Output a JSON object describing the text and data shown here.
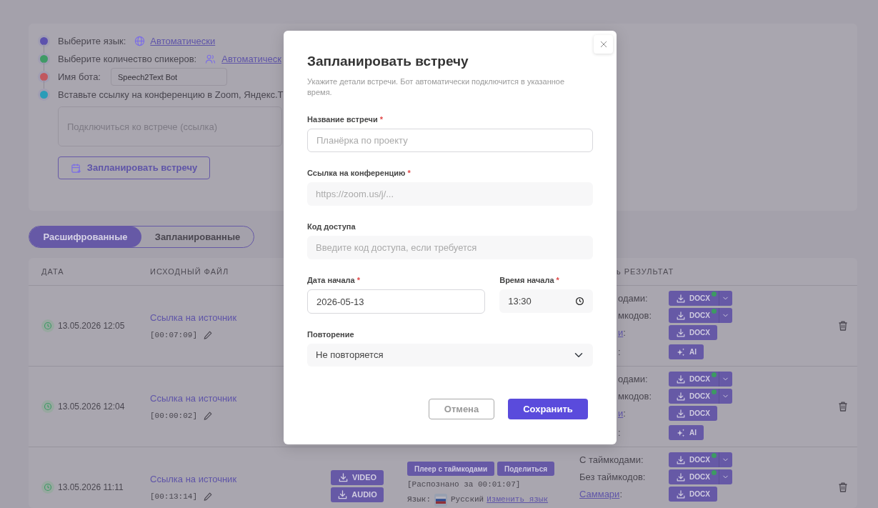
{
  "settings": {
    "items": [
      {
        "kind": "language",
        "color": "#5c52ad",
        "label": "Выберите язык:",
        "value": "Автоматически"
      },
      {
        "kind": "speakers",
        "color": "#3f9a66",
        "label": "Выберите количество спикеров:",
        "value": "Автоматическ"
      },
      {
        "kind": "bot_name",
        "color": "#c0575f",
        "label": "Имя бота:",
        "value": "Speech2Text Bot"
      },
      {
        "kind": "text",
        "color": "#2a9cb8",
        "label": "Вставьте ссылку на конференцию в Zoom, Яндекс.Т"
      }
    ],
    "link_field": {
      "placeholder": "Подключиться ко встрече (ссылка)"
    },
    "schedule_button": "Запланировать встречу"
  },
  "tabs": [
    {
      "label": "Расшифрованные",
      "selected": true
    },
    {
      "label": "Запланированные",
      "selected": false
    }
  ],
  "table": {
    "columns": [
      "ДАТА",
      "ИСХОДНЫЙ ФАЙЛ",
      "ь РЕЗУЛЬТАТ"
    ],
    "rows": [
      {
        "kind": "covered",
        "date": "13.05.2026 12:05",
        "source": "Ссылка на источник",
        "duration": "[00:07:09]",
        "results": [
          {
            "label": "одами:",
            "buttons": [
              {
                "kind": "download",
                "label": "DOCX",
                "split": true,
                "indicator": true
              }
            ]
          },
          {
            "label": "мкодов:",
            "buttons": [
              {
                "kind": "download",
                "label": "DOCX",
                "split": true,
                "indicator": true
              }
            ]
          },
          {
            "link": "и",
            "label": ":",
            "buttons": [
              {
                "kind": "download",
                "label": "DOCX",
                "split": false,
                "indicator": false
              }
            ]
          },
          {
            "kind": "ai",
            "label": ":",
            "buttons": [
              {
                "kind": "ai",
                "label": "AI",
                "split": false,
                "indicator": false
              }
            ]
          }
        ]
      },
      {
        "kind": "covered",
        "date": "13.05.2026 12:04",
        "source": "Ссылка на источник",
        "duration": "[00:00:02]",
        "results": [
          {
            "label": "одами:",
            "buttons": [
              {
                "kind": "download",
                "label": "DOCX",
                "split": true,
                "indicator": true
              }
            ]
          },
          {
            "label": "мкодов:",
            "buttons": [
              {
                "kind": "download",
                "label": "DOCX",
                "split": true,
                "indicator": true
              }
            ]
          },
          {
            "link": "и",
            "label": ":",
            "buttons": [
              {
                "kind": "download",
                "label": "DOCX",
                "split": false,
                "indicator": false
              }
            ]
          },
          {
            "kind": "ai",
            "label": ":",
            "buttons": [
              {
                "kind": "ai",
                "label": "AI",
                "split": false,
                "indicator": false
              }
            ]
          }
        ]
      },
      {
        "kind": "full",
        "date": "13.05.2026 11:11",
        "source": "Ссылка на источник",
        "duration": "[00:13:14]",
        "media": [
          "VIDEO",
          "AUDIO"
        ],
        "actions": [
          "Плеер с таймкодами",
          "Поделиться"
        ],
        "recognized": "[Распознано за 00:01:07]",
        "language_label": "Язык:",
        "language": "Русский",
        "change_language": "Изменить язык",
        "results": [
          {
            "label": "С таймкодами:",
            "buttons": [
              {
                "kind": "download",
                "label": "DOCX",
                "split": true,
                "indicator": true
              }
            ]
          },
          {
            "label": "Без таймкодов:",
            "buttons": [
              {
                "kind": "download",
                "label": "DOCX",
                "split": true,
                "indicator": true
              }
            ]
          },
          {
            "link": "Саммари",
            "label": ":",
            "buttons": [
              {
                "kind": "download",
                "label": "DOCX",
                "split": false,
                "indicator": false
              }
            ]
          }
        ]
      }
    ]
  },
  "dialog": {
    "title": "Запланировать встречу",
    "subtitle": "Укажите детали встречи. Бот автоматически подключится в указанное время.",
    "fields": [
      {
        "kind": "outlined",
        "label": "Название встречи",
        "required_mark": "*",
        "placeholder": "Планёрка по проекту"
      },
      {
        "kind": "filled",
        "label": "Ссылка на конференцию",
        "required_mark": "*",
        "placeholder": "https://zoom.us/j/..."
      },
      {
        "kind": "filled",
        "label": "Код доступа",
        "placeholder": "Введите код доступа, если требуется"
      },
      {
        "kind": "pair",
        "fields": [
          {
            "kind": "outlined",
            "label": "Дата начала",
            "required_mark": "*",
            "value": "2026-05-13"
          },
          {
            "kind": "time",
            "label": "Время начала",
            "required_mark": "*",
            "value": "13:30"
          }
        ]
      },
      {
        "kind": "select",
        "label": "Повторение",
        "value": "Не повторяется"
      }
    ],
    "cancel": "Отмена",
    "save": "Сохранить"
  }
}
